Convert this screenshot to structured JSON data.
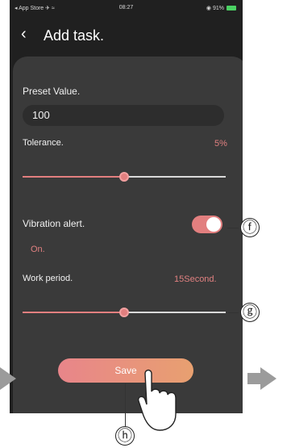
{
  "status_bar": {
    "left": "◂ App Store ✈ ≈",
    "time": "08:27",
    "battery": "◉ 91%"
  },
  "header": {
    "back_icon": "‹",
    "title": "Add task."
  },
  "form": {
    "preset_label": "Preset Value.",
    "preset_value": "100",
    "tolerance_label": "Tolerance.",
    "tolerance_value": "5%",
    "tolerance_slider_fraction": 0.5,
    "vibration_label": "Vibration alert.",
    "vibration_state": "On.",
    "vibration_toggle_on": true,
    "work_period_label": "Work period.",
    "work_period_value": "15Second.",
    "work_period_slider_fraction": 0.5,
    "save_label": "Save"
  },
  "callouts": {
    "f": "ⓕ",
    "g": "ⓖ",
    "h": "ⓗ"
  },
  "colors": {
    "accent": "#e27f7f",
    "card": "#3a3a3a",
    "background": "#202020"
  }
}
